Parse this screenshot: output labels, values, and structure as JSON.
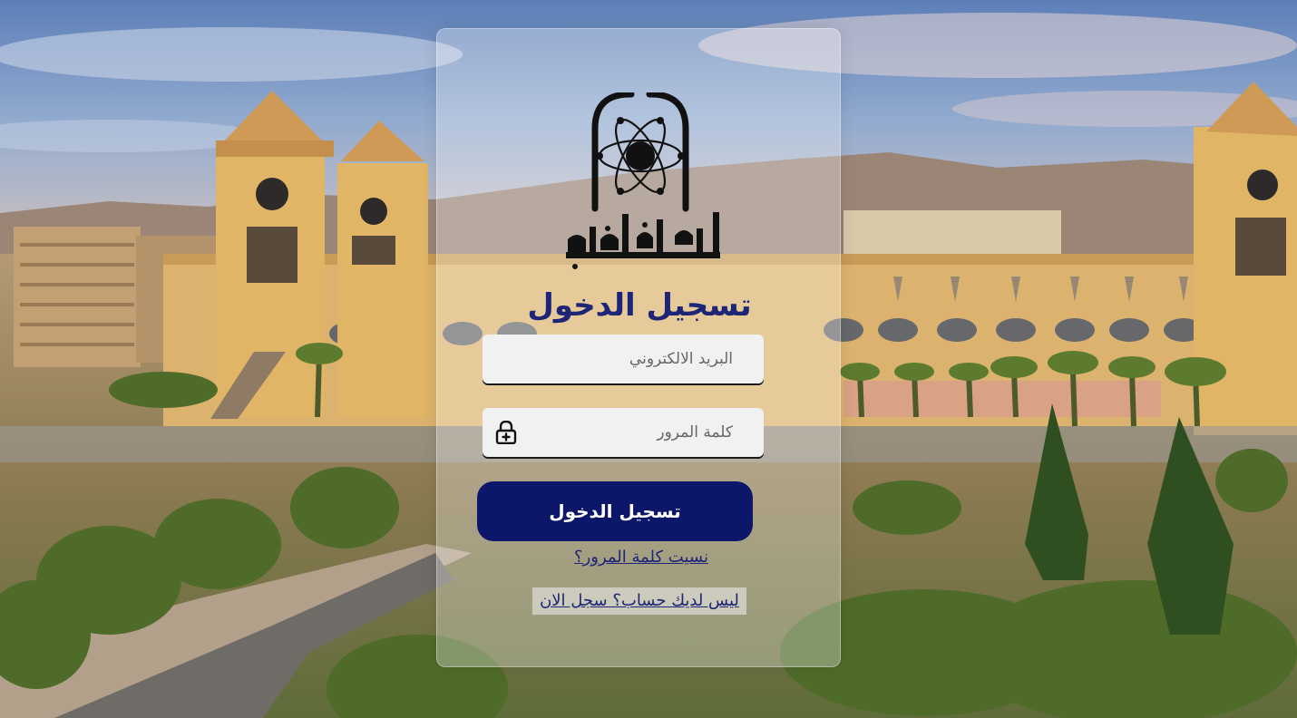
{
  "university": {
    "logo_text": "جامعة حلوان"
  },
  "login": {
    "title": "تسجيل الدخول",
    "email_placeholder": "البريد الالكتروني",
    "password_placeholder": "كلمة المرور",
    "submit_label": "تسجيل الدخول",
    "forgot_label": "نسيت كلمة المرور؟",
    "register_label": "ليس لديك حساب؟ سجل الان"
  },
  "icons": {
    "password_field": "lock-icon"
  },
  "colors": {
    "primary": "#0d1769",
    "title": "#1d2576",
    "field_bg": "#f1f1f1"
  }
}
